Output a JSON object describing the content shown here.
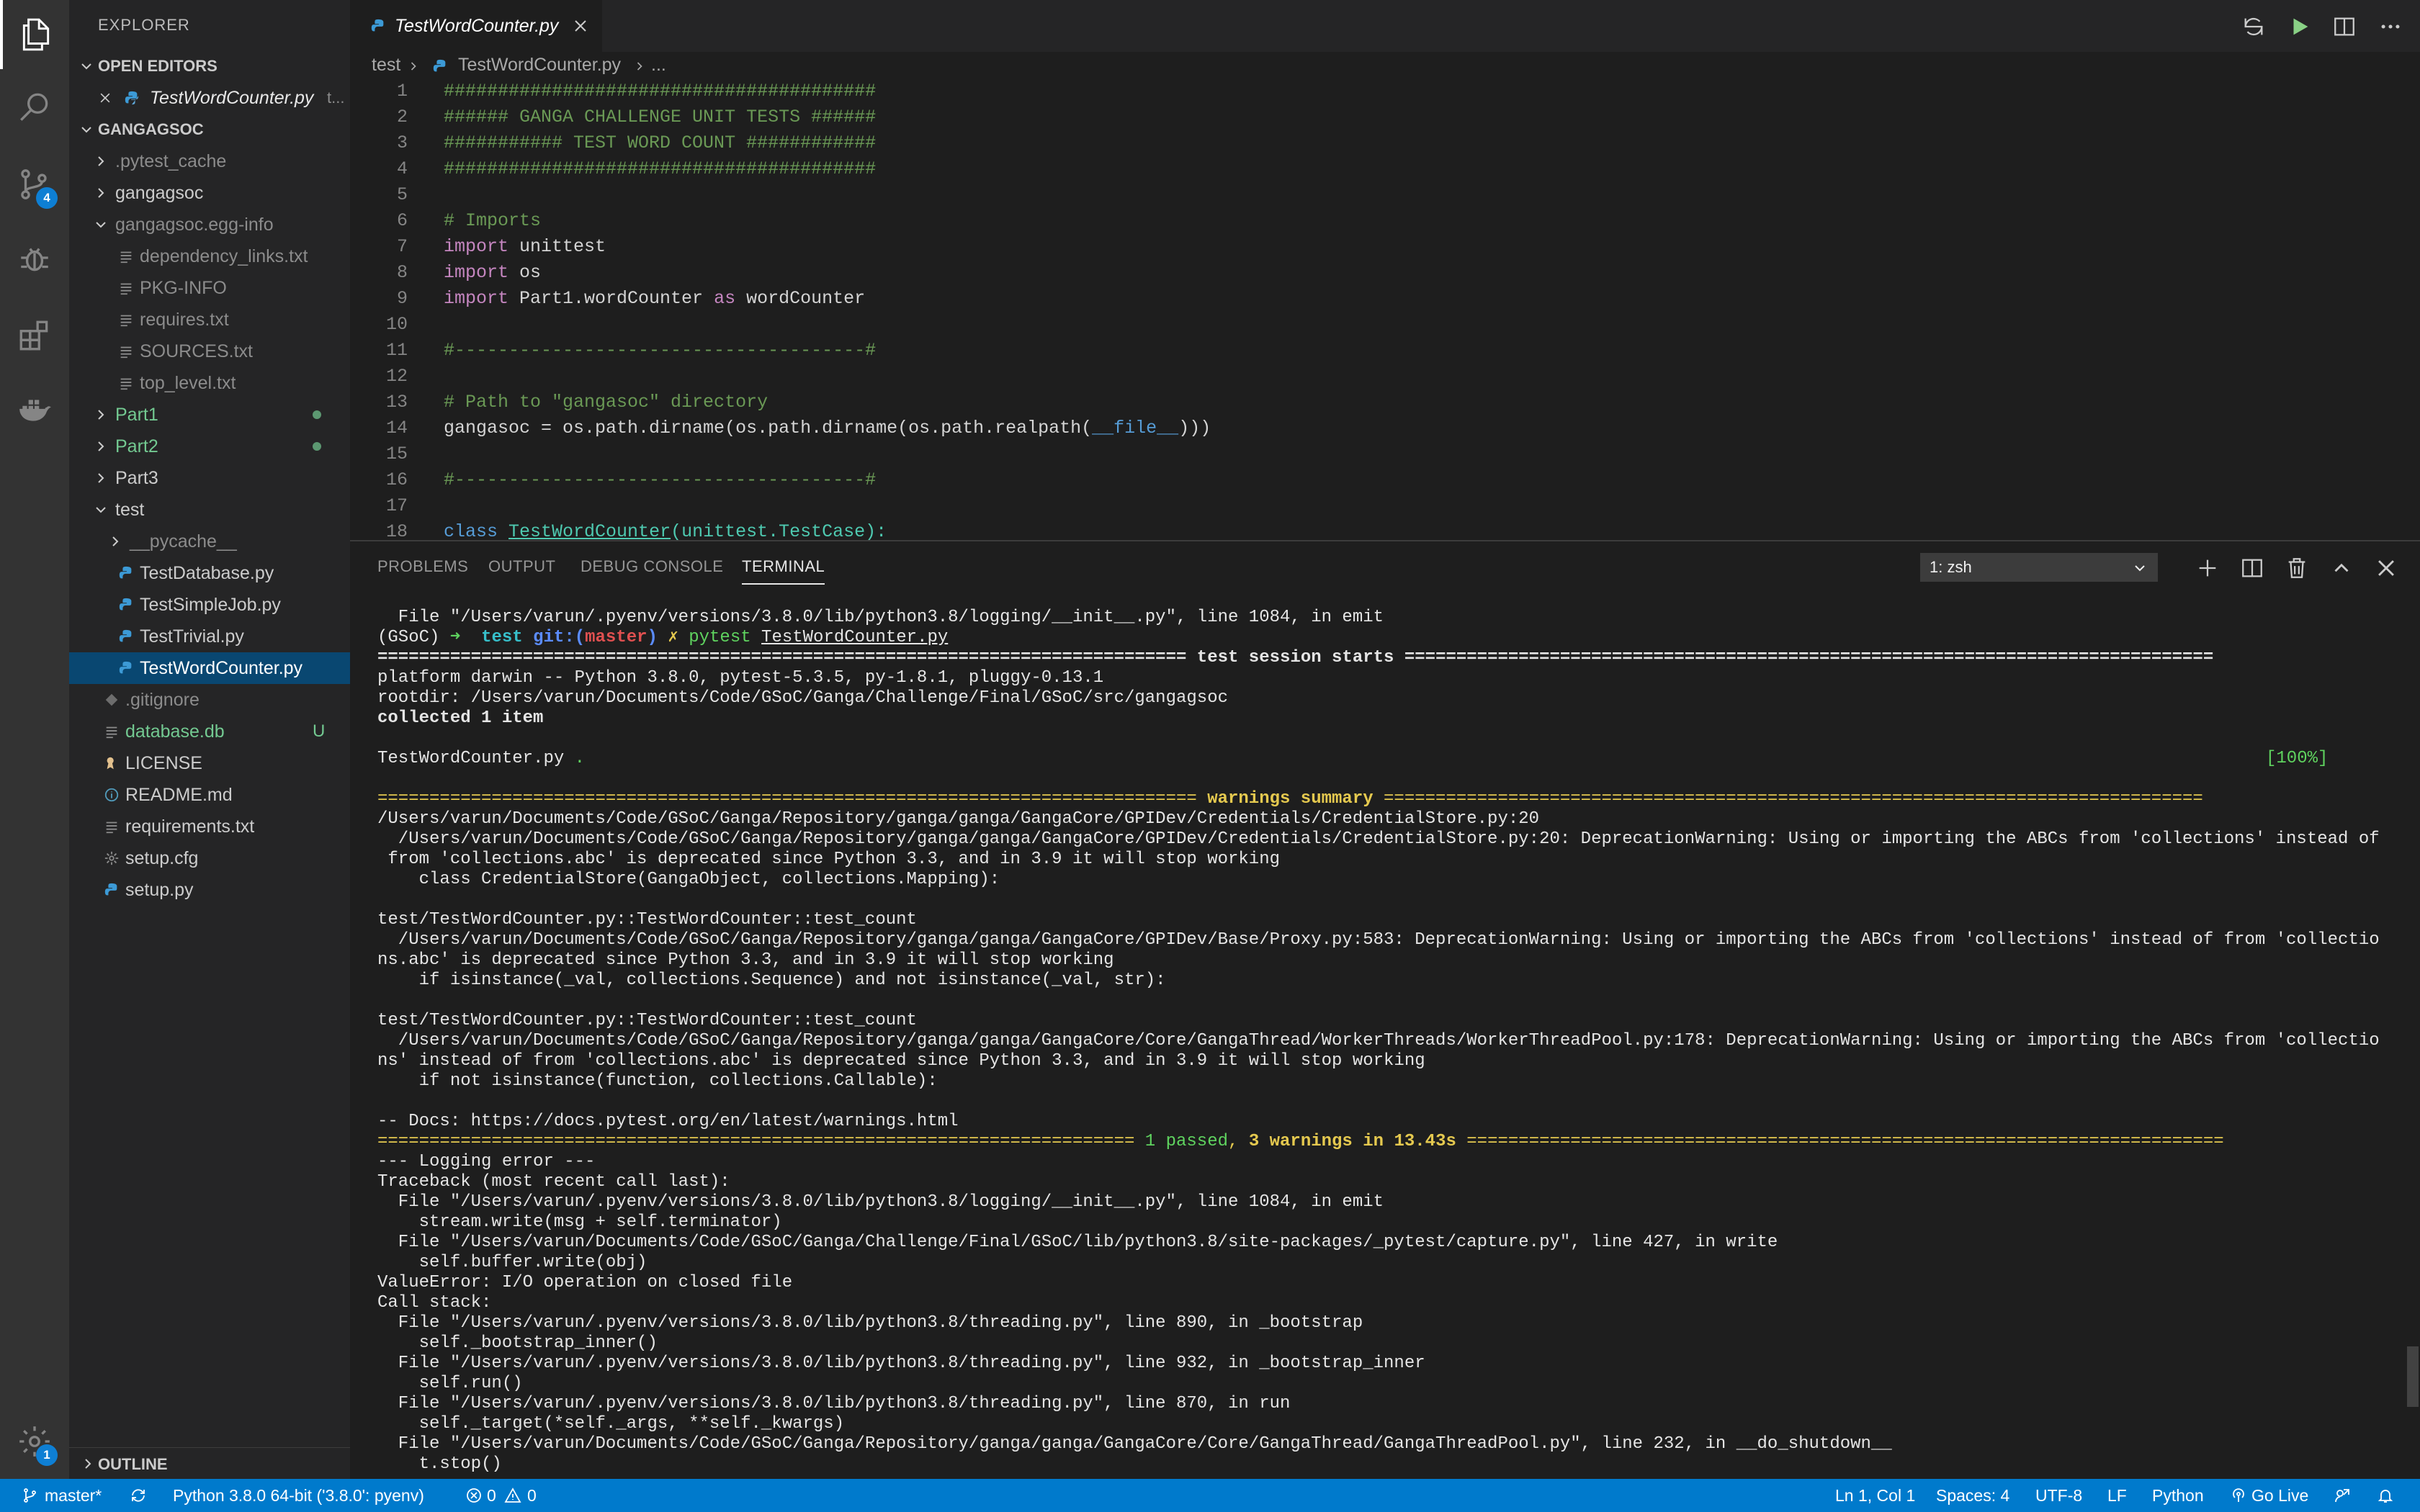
{
  "explorer": {
    "title": "EXPLORER",
    "open_editors": "OPEN EDITORS",
    "open_file": "TestWordCounter.py",
    "open_file_path": "t...",
    "project": "GANGAGSOC",
    "outline": "OUTLINE",
    "items": [
      {
        "label": ".pytest_cache",
        "color": "#8c8c8c"
      },
      {
        "label": "gangagsoc",
        "color": "#cccccc"
      },
      {
        "label": "gangagsoc.egg-info",
        "color": "#8c8c8c"
      },
      {
        "label": "dependency_links.txt",
        "color": "#8c8c8c"
      },
      {
        "label": "PKG-INFO",
        "color": "#8c8c8c"
      },
      {
        "label": "requires.txt",
        "color": "#8c8c8c"
      },
      {
        "label": "SOURCES.txt",
        "color": "#8c8c8c"
      },
      {
        "label": "top_level.txt",
        "color": "#8c8c8c"
      },
      {
        "label": "Part1",
        "color": "#73c991"
      },
      {
        "label": "Part2",
        "color": "#73c991"
      },
      {
        "label": "Part3",
        "color": "#cccccc"
      },
      {
        "label": "test",
        "color": "#cccccc"
      },
      {
        "label": "__pycache__",
        "color": "#8c8c8c"
      },
      {
        "label": "TestDatabase.py",
        "color": "#cccccc"
      },
      {
        "label": "TestSimpleJob.py",
        "color": "#cccccc"
      },
      {
        "label": "TestTrivial.py",
        "color": "#cccccc"
      },
      {
        "label": "TestWordCounter.py",
        "color": "#ffffff"
      },
      {
        "label": ".gitignore",
        "color": "#8c8c8c"
      },
      {
        "label": "database.db",
        "color": "#73c991"
      },
      {
        "label": "LICENSE",
        "color": "#cccccc"
      },
      {
        "label": "README.md",
        "color": "#cccccc"
      },
      {
        "label": "requirements.txt",
        "color": "#cccccc"
      },
      {
        "label": "setup.cfg",
        "color": "#cccccc"
      },
      {
        "label": "setup.py",
        "color": "#cccccc"
      }
    ],
    "untracked_badge": "U",
    "scm_count": "4",
    "settings_count": "1"
  },
  "editor": {
    "tab_label": "TestWordCounter.py",
    "breadcrumb": [
      "test",
      "TestWordCounter.py",
      "..."
    ],
    "line_numbers": [
      "1",
      "2",
      "3",
      "4",
      "5",
      "6",
      "7",
      "8",
      "9",
      "10",
      "11",
      "12",
      "13",
      "14",
      "15",
      "16",
      "17",
      "18"
    ],
    "lines": {
      "l1": "########################################",
      "l2": "###### GANGA CHALLENGE UNIT TESTS ######",
      "l3": "########### TEST WORD COUNT ############",
      "l4": "########################################",
      "l6": "# Imports",
      "l7_kw": "import",
      "l7": " unittest",
      "l8_kw": "import",
      "l8": " os",
      "l9_kw": "import",
      "l9": " Part1.wordCounter ",
      "l9_as": "as",
      "l9_b": " wordCounter",
      "l11": "#--------------------------------------#",
      "l13": "# Path to \"gangasoc\" directory",
      "l14a": "gangasoc = os.path.dirname(os.path.dirname(os.path.realpath(",
      "l14b": "__file__",
      "l14c": ")))",
      "l16": "#--------------------------------------#",
      "l18_kw": "class",
      "l18_name": "TestWordCounter",
      "l18_rest": "(unittest.TestCase):"
    }
  },
  "panel": {
    "tabs": [
      "PROBLEMS",
      "OUTPUT",
      "DEBUG CONSOLE",
      "TERMINAL"
    ],
    "terminal_select": "1: zsh",
    "terminal": {
      "t1": "  File \"/Users/varun/.pyenv/versions/3.8.0/lib/python3.8/logging/__init__.py\", line 1084, in emit",
      "p_env": "(GSoC) ",
      "p_arrow": "➜",
      "p_dir": "  test ",
      "p_git": "git:(",
      "p_branch": "master",
      "p_git_end": ")",
      "p_x": " ✗ ",
      "p_cmd": "pytest",
      "p_space": " ",
      "p_arg": "TestWordCounter.py",
      "sess_l": "============================================================================== ",
      "sess_t": "test session starts",
      "sess_r": " ==============================================================================",
      "t4": "platform darwin -- Python 3.8.0, pytest-5.3.5, py-1.8.1, pluggy-0.13.1",
      "t5": "rootdir: /Users/varun/Documents/Code/GSoC/Ganga/Challenge/Final/GSoC/src/gangagsoc",
      "t6": "collected 1 item",
      "t8a": "TestWordCounter.py ",
      "t8b": ".",
      "t8c": "[100%]",
      "warn_l": "=============================================================================== ",
      "warn_t": "warnings summary",
      "warn_r": " ===============================================================================",
      "t11": "/Users/varun/Documents/Code/GSoC/Ganga/Repository/ganga/ganga/GangaCore/GPIDev/Credentials/CredentialStore.py:20",
      "t12": "  /Users/varun/Documents/Code/GSoC/Ganga/Repository/ganga/ganga/GangaCore/GPIDev/Credentials/CredentialStore.py:20: DeprecationWarning: Using or importing the ABCs from 'collections' instead of",
      "t13": " from 'collections.abc' is deprecated since Python 3.3, and in 3.9 it will stop working",
      "t14": "    class CredentialStore(GangaObject, collections.Mapping):",
      "t16": "test/TestWordCounter.py::TestWordCounter::test_count",
      "t17": "  /Users/varun/Documents/Code/GSoC/Ganga/Repository/ganga/ganga/GangaCore/GPIDev/Base/Proxy.py:583: DeprecationWarning: Using or importing the ABCs from 'collections' instead of from 'collectio",
      "t18": "ns.abc' is deprecated since Python 3.3, and in 3.9 it will stop working",
      "t19": "    if isinstance(_val, collections.Sequence) and not isinstance(_val, str):",
      "t21": "test/TestWordCounter.py::TestWordCounter::test_count",
      "t22": "  /Users/varun/Documents/Code/GSoC/Ganga/Repository/ganga/ganga/GangaCore/Core/GangaThread/WorkerThreads/WorkerThreadPool.py:178: DeprecationWarning: Using or importing the ABCs from 'collectio",
      "t23": "ns' instead of from 'collections.abc' is deprecated since Python 3.3, and in 3.9 it will stop working",
      "t24": "    if not isinstance(function, collections.Callable):",
      "t26": "-- Docs: https://docs.pytest.org/en/latest/warnings.html",
      "res_l": "========================================================================= ",
      "res_p": "1 passed",
      "res_c": ", ",
      "res_w": "3 warnings",
      "res_t": " in 13.43s",
      "res_r": " =========================================================================",
      "t28": "--- Logging error ---",
      "t29": "Traceback (most recent call last):",
      "t30": "  File \"/Users/varun/.pyenv/versions/3.8.0/lib/python3.8/logging/__init__.py\", line 1084, in emit",
      "t31": "    stream.write(msg + self.terminator)",
      "t32": "  File \"/Users/varun/Documents/Code/GSoC/Ganga/Challenge/Final/GSoC/lib/python3.8/site-packages/_pytest/capture.py\", line 427, in write",
      "t33": "    self.buffer.write(obj)",
      "t34": "ValueError: I/O operation on closed file",
      "t35": "Call stack:",
      "t36": "  File \"/Users/varun/.pyenv/versions/3.8.0/lib/python3.8/threading.py\", line 890, in _bootstrap",
      "t37": "    self._bootstrap_inner()",
      "t38": "  File \"/Users/varun/.pyenv/versions/3.8.0/lib/python3.8/threading.py\", line 932, in _bootstrap_inner",
      "t39": "    self.run()",
      "t40": "  File \"/Users/varun/.pyenv/versions/3.8.0/lib/python3.8/threading.py\", line 870, in run",
      "t41": "    self._target(*self._args, **self._kwargs)",
      "t42": "  File \"/Users/varun/Documents/Code/GSoC/Ganga/Repository/ganga/ganga/GangaCore/Core/GangaThread/GangaThreadPool.py\", line 232, in __do_shutdown__",
      "t43": "    t.stop()"
    }
  },
  "statusbar": {
    "branch": "master*",
    "python": "Python 3.8.0 64-bit ('3.8.0': pyenv)",
    "errors": "0",
    "warnings": "0",
    "position": "Ln 1, Col 1",
    "spaces": "Spaces: 4",
    "encoding": "UTF-8",
    "eol": "LF",
    "language": "Python",
    "golive": "Go Live"
  }
}
